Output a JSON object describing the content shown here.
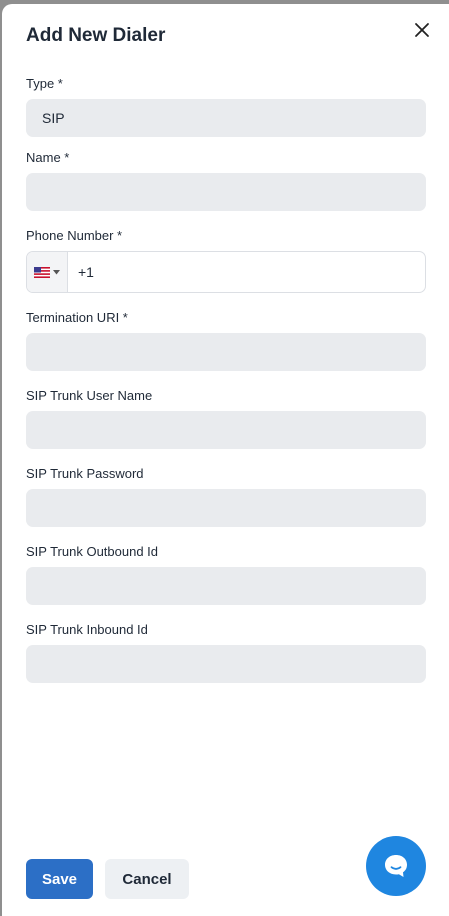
{
  "dialog": {
    "title": "Add New Dialer",
    "close_icon": "close-icon"
  },
  "form": {
    "type_label": "Type *",
    "type_value": "SIP",
    "name_label": "Name *",
    "name_value": "",
    "phone_label": "Phone Number *",
    "phone_country_icon": "us-flag-icon",
    "phone_value": "+1",
    "termination_uri_label": "Termination URI *",
    "termination_uri_value": "",
    "sip_user_label": "SIP Trunk User Name",
    "sip_user_value": "",
    "sip_password_label": "SIP Trunk Password",
    "sip_password_value": "",
    "sip_outbound_label": "SIP Trunk Outbound Id",
    "sip_outbound_value": "",
    "sip_inbound_label": "SIP Trunk Inbound Id",
    "sip_inbound_value": ""
  },
  "actions": {
    "save_label": "Save",
    "cancel_label": "Cancel"
  },
  "chat": {
    "icon": "chat-bubble-icon"
  },
  "colors": {
    "primary": "#2c6fc6",
    "chat_fab": "#1f86e0",
    "field_bg": "#e9ebee"
  }
}
